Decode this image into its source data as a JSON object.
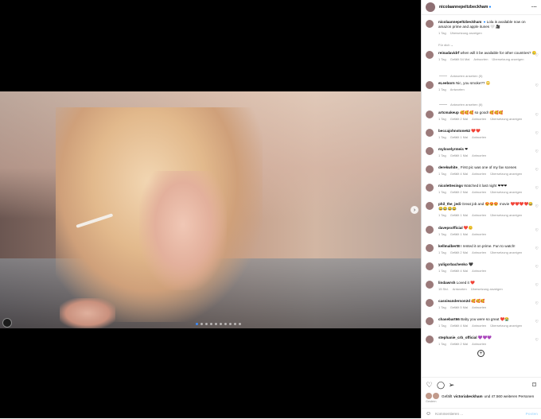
{
  "post": {
    "author": "nicolaannepeltzbeckham",
    "caption_user": "nicolaannepeltzbeckham",
    "caption": "Lola is available now on amazon prime and apple itunes 🤍 🎥",
    "caption_time": "1 Tag",
    "caption_translate": "Übersetzung anzeigen",
    "for_you": "Für dich ⌄"
  },
  "comments": [
    {
      "user": "reinadavidrf",
      "text": "when will it be available for other countries? 🥲",
      "time": "1 Tag",
      "likes": "Gefällt 54 Mal",
      "reply": "Antworten",
      "translate": "Übersetzung anzeigen",
      "replies": "Antworten ansehen (5)"
    },
    {
      "user": "eLeeborn",
      "text": "Nic, you smoke?? 😳",
      "time": "1 Tag",
      "reply": "Antworten",
      "replies": "Antworten ansehen (6)"
    },
    {
      "user": "artcmakeup",
      "text": "🥰🥰🥰 so good! 🥰🥰🥰",
      "time": "1 Tag",
      "likes": "Gefällt 2 Mal",
      "reply": "Antworten",
      "translate": "Übersetzung anzeigen"
    },
    {
      "user": "beccajohnstone52",
      "text": "❤️❤️",
      "time": "1 Tag",
      "likes": "Gefällt 1 Mal",
      "reply": "Antworten"
    },
    {
      "user": "mylovelyrmeis",
      "text": "❤",
      "time": "1 Tag",
      "likes": "Gefällt 1 Mal",
      "reply": "Antworten"
    },
    {
      "user": "derekwhite_",
      "text": "First pic was one of my fav scenes",
      "time": "1 Tag",
      "likes": "Gefällt 4 Mal",
      "reply": "Antworten",
      "translate": "Übersetzung anzeigen"
    },
    {
      "user": "nicolettesings",
      "text": "Watched it last night ❤❤❤",
      "time": "1 Tag",
      "likes": "Gefällt 2 Mal",
      "reply": "Antworten",
      "translate": "Übersetzung anzeigen"
    },
    {
      "user": "phil_the_jedi",
      "text": "Great job and 😍😍😍 movie ❤️❤️❤️❤️😂😂😂😂😂",
      "time": "1 Tag",
      "likes": "Gefällt 1 Mal",
      "reply": "Antworten",
      "translate": "Übersetzung anzeigen"
    },
    {
      "user": "davepsofficial",
      "text": "❤️😊",
      "time": "1 Tag",
      "likes": "Gefällt 1 Mal",
      "reply": "Antworten"
    },
    {
      "user": "kellmalbert8",
      "text": "I rented it on prime. Fun to watch!",
      "time": "1 Tag",
      "likes": "Gefällt 2 Mal",
      "reply": "Antworten",
      "translate": "Übersetzung anzeigen"
    },
    {
      "user": "yuligorbachenko",
      "text": "🖤",
      "time": "1 Tag",
      "likes": "Gefällt 4 Mal",
      "reply": "Antworten"
    },
    {
      "user": "lindawrsh",
      "text": "Loved it ❤️",
      "time": "15 Std.",
      "reply": "Antworten",
      "translate": "Übersetzung anzeigen"
    },
    {
      "user": "cassieanderson2d",
      "text": "🥰🥰🥰",
      "time": "1 Tag",
      "likes": "Gefällt 5 Mal",
      "reply": "Antworten"
    },
    {
      "user": "chasebart66",
      "text": "Baby you were so great ❤️😭",
      "time": "1 Tag",
      "likes": "Gefällt 4 Mal",
      "reply": "Antworten",
      "translate": "Übersetzung anzeigen"
    },
    {
      "user": "stephanie_crb_official",
      "text": "💜💜💜",
      "time": "1 Tag",
      "likes": "Gefällt 2 Mal",
      "reply": "Antworten"
    }
  ],
  "footer": {
    "likes_user": "victoriabeckham",
    "likes_prefix": "Gefällt",
    "likes_suffix": "und 47.560 weiteren Personen",
    "date": "Gestern",
    "comment_placeholder": "Kommentieren ...",
    "post_label": "Posten"
  },
  "icons": {
    "like": "heart-icon",
    "comment": "comment-icon",
    "share": "paper-plane-icon",
    "save": "bookmark-icon",
    "emoji": "smiley-icon"
  },
  "carousel": {
    "slides": 10,
    "active": 1
  }
}
